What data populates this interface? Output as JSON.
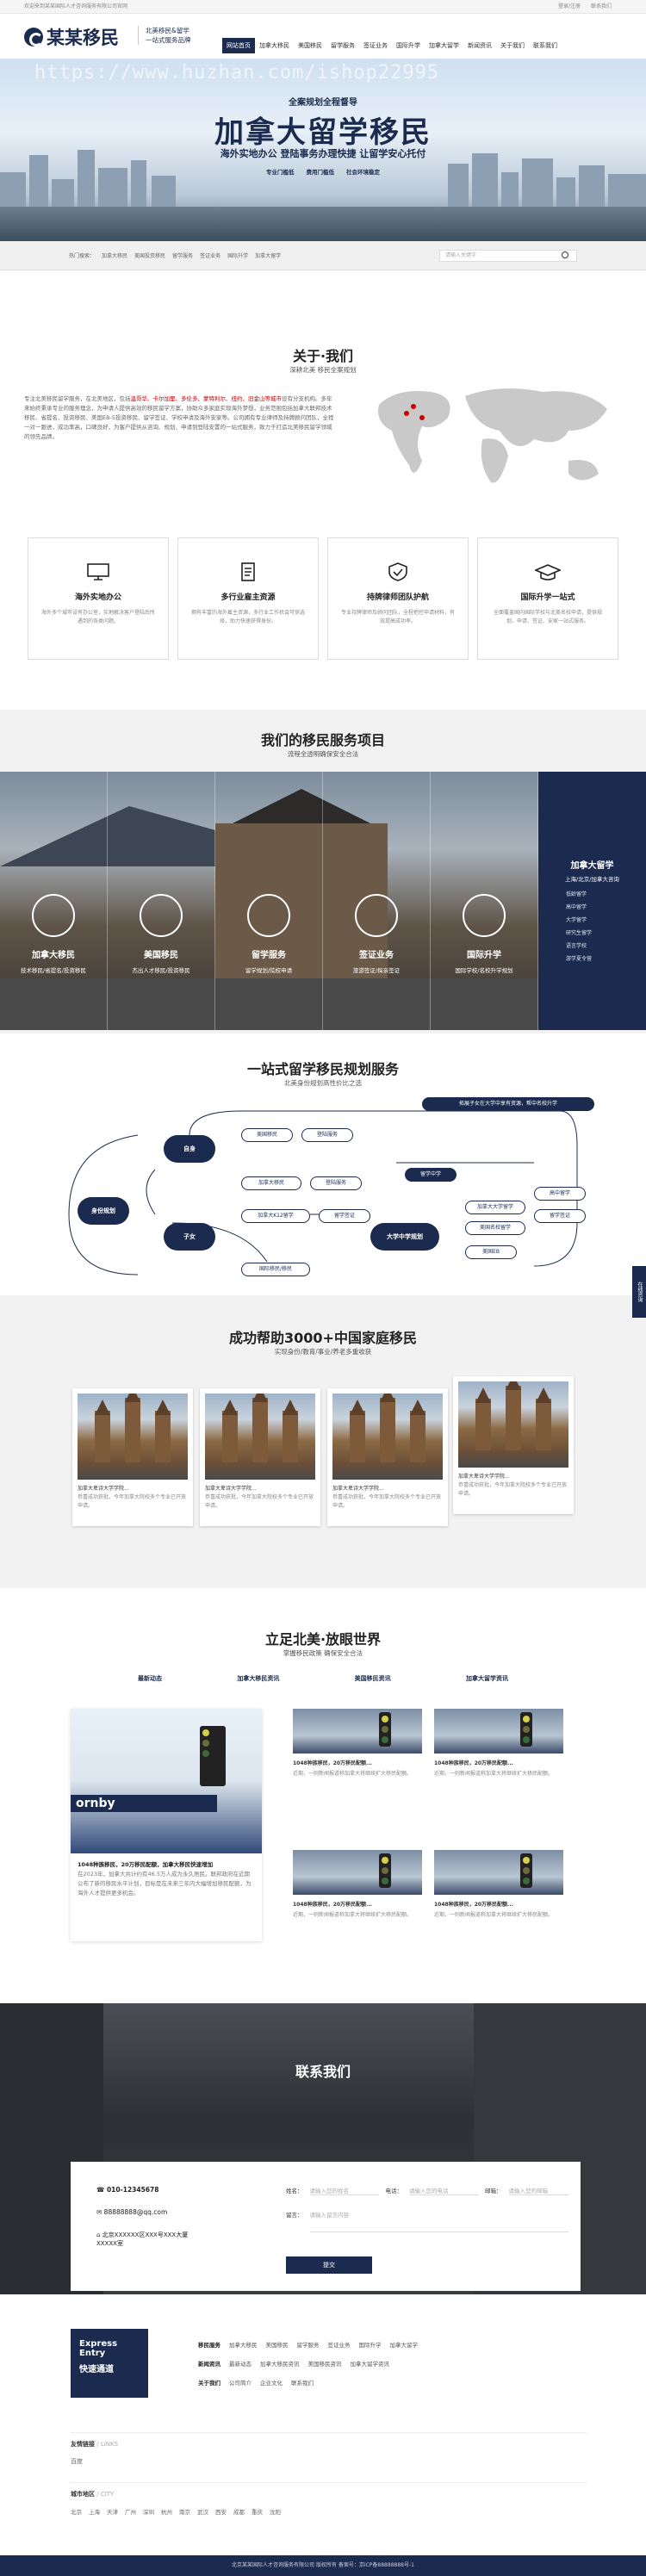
{
  "topbar": {
    "left": "欢迎来到某某国际人才咨询服务有限公司官网",
    "login": "登录/注册",
    "contact": "联系我们"
  },
  "header": {
    "logo_text": "某某移民",
    "slogan1": "北美移民&留学",
    "slogan2": "一站式服务品牌"
  },
  "nav": [
    "网站首页",
    "加拿大移民",
    "美国移民",
    "留学服务",
    "签证业务",
    "国际升学",
    "加拿大留学",
    "新闻资讯",
    "关于我们",
    "联系我们"
  ],
  "hero": {
    "sub1": "全案规划全程督导",
    "title": "加拿大留学移民",
    "sub2": "海外实地办公  登陆事务办理快捷  让留学安心托付",
    "tags": [
      "专业门槛低",
      "费用门槛低",
      "社会环境稳定"
    ],
    "watermark": "https://www.huzhan.com/ishop22995"
  },
  "subnav": {
    "links": [
      "热门搜索：",
      "加拿大移民",
      "美国投资移民",
      "留学服务",
      "签证业务",
      "国际升学",
      "加拿大留学"
    ],
    "search_placeholder": "请输入关键字"
  },
  "about": {
    "title": "关于·我们",
    "subtitle": "深耕北美 移民全案规划",
    "p1": "专注北美移民留学服务，在北美地区，包括",
    "highlight": "温哥华、卡尔加里、多伦多、蒙特利尔、纽约、旧金山等城市",
    "p2": "设有分支机构。多年来始终秉承专业的服务理念，为申请人提供高效的移民留学方案，协助众多家庭实现海外梦想，业务范围包括加拿大联邦技术移民、省提名、投资移民、美国EB-5投资移民、留学签证、学校申请及海外安家等。公司拥有专业律师及持牌顾问团队，全程一对一跟进，成功率高，口碑良好，为客户提供从咨询、规划、申请到登陆安置的一站式服务，致力于打造北美移民留学领域的领先品牌。"
  },
  "cards": [
    {
      "title": "海外实地办公",
      "desc": "海外多个城市设有办公室，实地解决客户登陆后所遇到的各类问题。"
    },
    {
      "title": "多行业雇主资源",
      "desc": "拥有丰富的海外雇主资源，多行业工作机会可供选择，助力快速获得身份。"
    },
    {
      "title": "持牌律师团队护航",
      "desc": "专业持牌律师及顾问团队，全程把控申请材料，有效提高成功率。"
    },
    {
      "title": "国际升学一站式",
      "desc": "全面覆盖国内国际学校与北美名校申请，提供规划、申请、签证、安家一站式服务。"
    }
  ],
  "projects": {
    "title": "我们的移民服务项目",
    "subtitle": "流程全透明确保安全合法",
    "items": [
      {
        "name": "加拿大移民",
        "desc": "技术移民/省提名/投资移民"
      },
      {
        "name": "美国移民",
        "desc": "杰出人才移民/投资移民"
      },
      {
        "name": "留学服务",
        "desc": "留学规划/院校申请"
      },
      {
        "name": "签证业务",
        "desc": "旅游签证/探亲签证"
      },
      {
        "name": "国际升学",
        "desc": "国际学校/名校升学规划"
      }
    ],
    "side_title": "加拿大留学",
    "side_sub": "上海/北京/加拿大咨询",
    "side_list": [
      "低龄留学",
      "高中留学",
      "大学留学",
      "研究生留学",
      "语言学校",
      "游学夏令营"
    ]
  },
  "flow": {
    "title": "一站式留学移民规划服务",
    "subtitle": "北美身份规划高性价比之选",
    "b1": "自身",
    "b2": "身份规划",
    "b3": "子女",
    "b4": "大学中学规划",
    "pills": [
      "美国移民",
      "登陆服务",
      "加拿大移民",
      "登陆服务",
      "加拿大K12留学",
      "留学签证",
      "国际移民/移民",
      "美国名校留学",
      "留学签证",
      "美国EB",
      "加拿大大学留学",
      "高中留学"
    ],
    "tag1": "拓展子女在大学中享有资源，帮中名校升学",
    "tag2": "留学中学"
  },
  "success": {
    "title": "成功帮助3000+中国家庭移民",
    "subtitle": "实现身份/教育/事业/养老多重收获",
    "items": [
      {
        "t": "加拿大卑诗大学学院...",
        "d": "恭喜成功获批，今年加拿大院校多个专业已开放申请。"
      },
      {
        "t": "加拿大卑诗大学学院...",
        "d": "恭喜成功获批，今年加拿大院校多个专业已开放申请。"
      },
      {
        "t": "加拿大卑诗大学学院...",
        "d": "恭喜成功获批，今年加拿大院校多个专业已开放申请。"
      },
      {
        "t": "加拿大卑诗大学学院...",
        "d": "恭喜成功获批，今年加拿大院校多个专业已开放申请。"
      }
    ]
  },
  "news": {
    "title": "立足北美·放眼世界",
    "subtitle": "掌握移民政策 确保安全合法",
    "tabs": [
      "最新动态",
      "加拿大移民资讯",
      "美国移民资讯",
      "加拿大留学资讯"
    ],
    "big_title": "1048种族移民，20万移民配额，加拿大移民快速增加",
    "big_desc": "在2023年，加拿大共计约有46.5万人成为永久居民。联邦政府在近期公布了新的移民水平计划，目标是在未来三年内大幅增加移民配额，为海外人才提供更多机会。",
    "small": [
      {
        "t": "1048种族移民，20万移民配额...",
        "d": "近期，一则新闻报道称加拿大将继续扩大移民配额。"
      },
      {
        "t": "1048种族移民，20万移民配额...",
        "d": "近期，一则新闻报道称加拿大将继续扩大移民配额。"
      },
      {
        "t": "1048种族移民，20万移民配额...",
        "d": "近期，一则新闻报道称加拿大将继续扩大移民配额。"
      },
      {
        "t": "1048种族移民，20万移民配额...",
        "d": "近期，一则新闻报道称加拿大将继续扩大移民配额。"
      }
    ]
  },
  "contact": {
    "title": "联系我们",
    "phone": "010-12345678",
    "email": "88888888@qq.com",
    "address": "北京XXXXXX区XXX号XXX大厦XXXXX室",
    "f_name": "姓名：",
    "p_name": "请输入您的姓名",
    "f_phone": "电话：",
    "p_phone": "请输入您的电话",
    "f_email": "邮箱：",
    "p_email": "请输入您的邮箱",
    "f_msg": "留言：",
    "p_msg": "请输入留言内容",
    "submit": "提交"
  },
  "footer": {
    "express1": "Express",
    "express2": "Entry",
    "express3": "快速通道",
    "groups": [
      {
        "h": "移民服务",
        "items": [
          "加拿大移民",
          "美国移民",
          "留学服务",
          "签证业务",
          "国际升学",
          "加拿大留学"
        ]
      },
      {
        "h": "新闻资讯",
        "items": [
          "最新动态",
          "加拿大移民资讯",
          "美国移民资讯",
          "加拿大留学资讯"
        ]
      },
      {
        "h": "关于我们",
        "items": [
          "公司简介",
          "企业文化",
          "联系我们"
        ]
      }
    ],
    "links_title": "友情链接",
    "links_en": "/ LINKS",
    "links": [
      "百度"
    ],
    "city_title": "城市地区",
    "city_en": "/ CITY",
    "cities": [
      "北京",
      "上海",
      "天津",
      "广州",
      "深圳",
      "杭州",
      "南京",
      "武汉",
      "西安",
      "成都",
      "重庆",
      "沈阳"
    ],
    "copyright": "北京某某国际人才咨询服务有限公司 版权所有 备案号：京ICP备88888888号-1"
  },
  "float": "在线咨询"
}
